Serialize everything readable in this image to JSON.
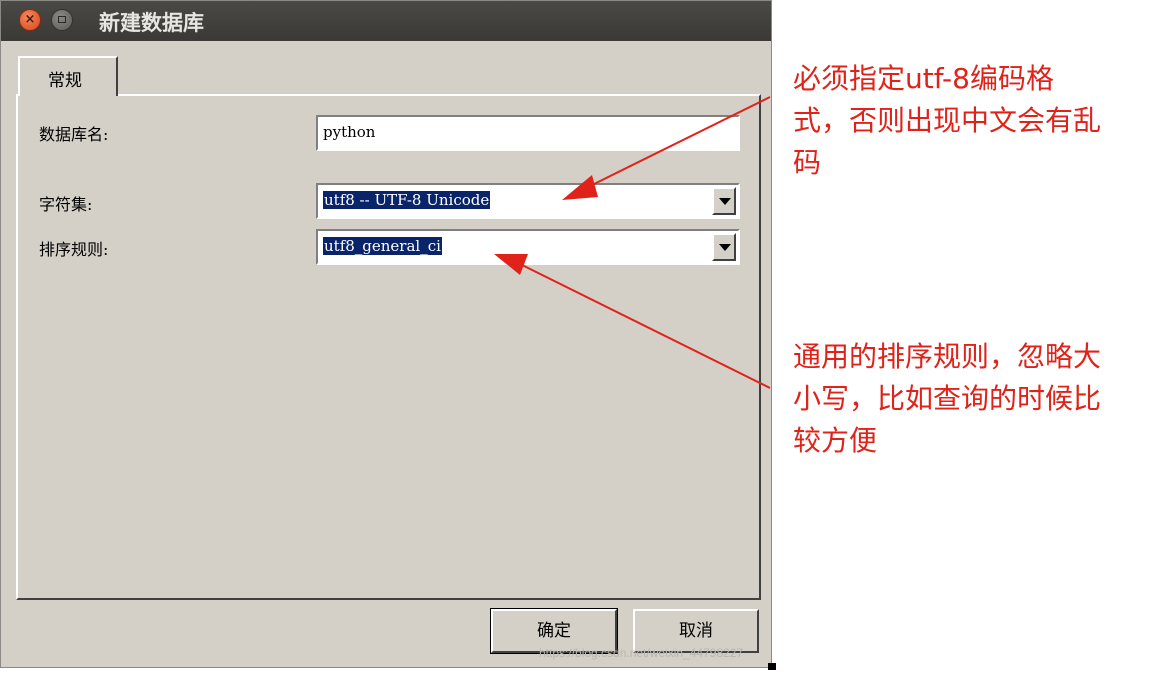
{
  "window": {
    "title": "新建数据库"
  },
  "tabs": [
    {
      "label": "常规"
    }
  ],
  "form": {
    "name_label": "数据库名:",
    "name_value": "python",
    "charset_label": "字符集:",
    "charset_value": "utf8 -- UTF-8 Unicode",
    "collation_label": "排序规则:",
    "collation_value": "utf8_general_ci"
  },
  "buttons": {
    "ok": "确定",
    "cancel": "取消"
  },
  "annotations": {
    "charset_note": [
      "必须指定utf-8编码格",
      "式，否则出现中文会有乱",
      "码"
    ],
    "collation_note": [
      "通用的排序规则，忽略大",
      "小写，比如查询的时候比",
      "较方便"
    ]
  },
  "watermark": "https://blog.csdn.net/weixin_44798227",
  "colors": {
    "annotation": "#e0231a",
    "selection": "#0a246a",
    "dialog_bg": "#d4d0c8"
  }
}
